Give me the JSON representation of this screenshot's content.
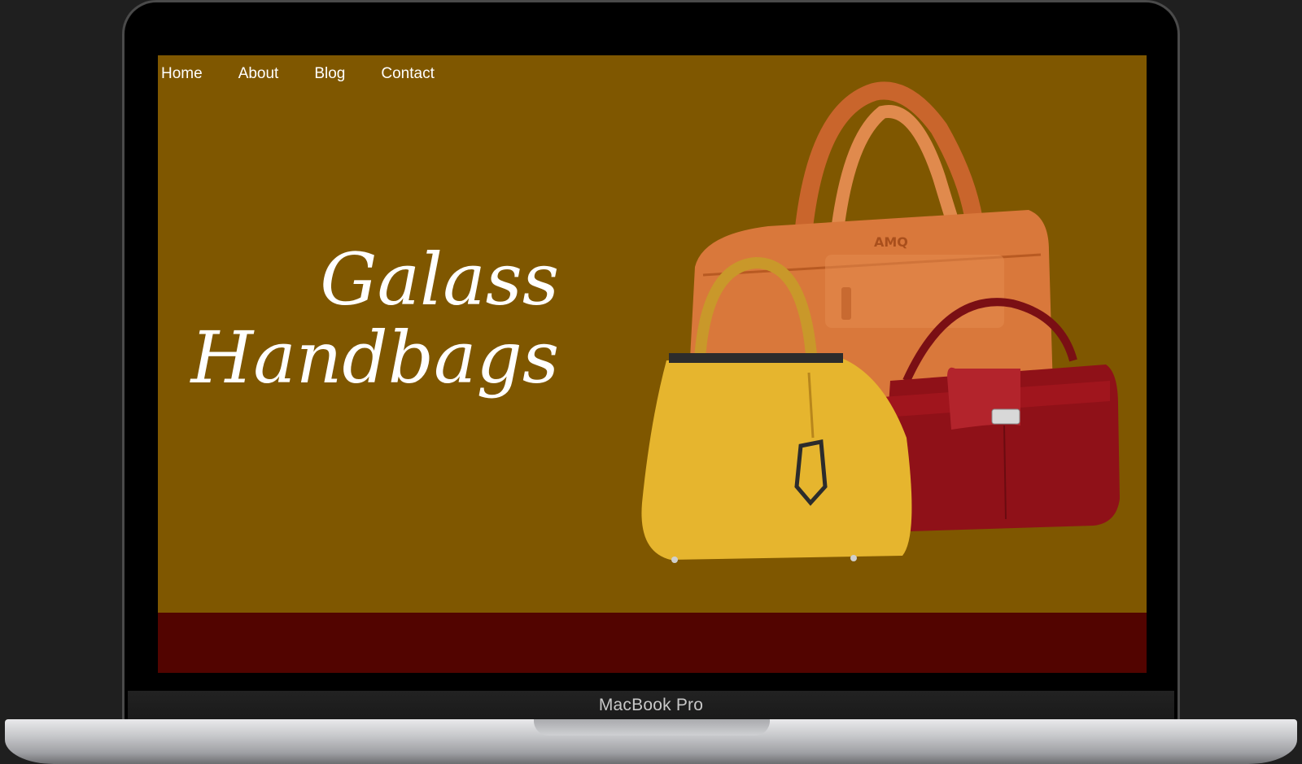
{
  "nav": {
    "items": [
      {
        "label": "Home"
      },
      {
        "label": "About"
      },
      {
        "label": "Blog"
      },
      {
        "label": "Contact"
      }
    ]
  },
  "hero": {
    "title_line1": "Galass",
    "title_line2": "Handbags"
  },
  "device": {
    "label": "MacBook Pro"
  },
  "colors": {
    "page_background": "#7f5700",
    "footer_band": "#520400",
    "bag_orange": "#d9783b",
    "bag_yellow": "#e6b52e",
    "bag_red": "#8f1118"
  }
}
